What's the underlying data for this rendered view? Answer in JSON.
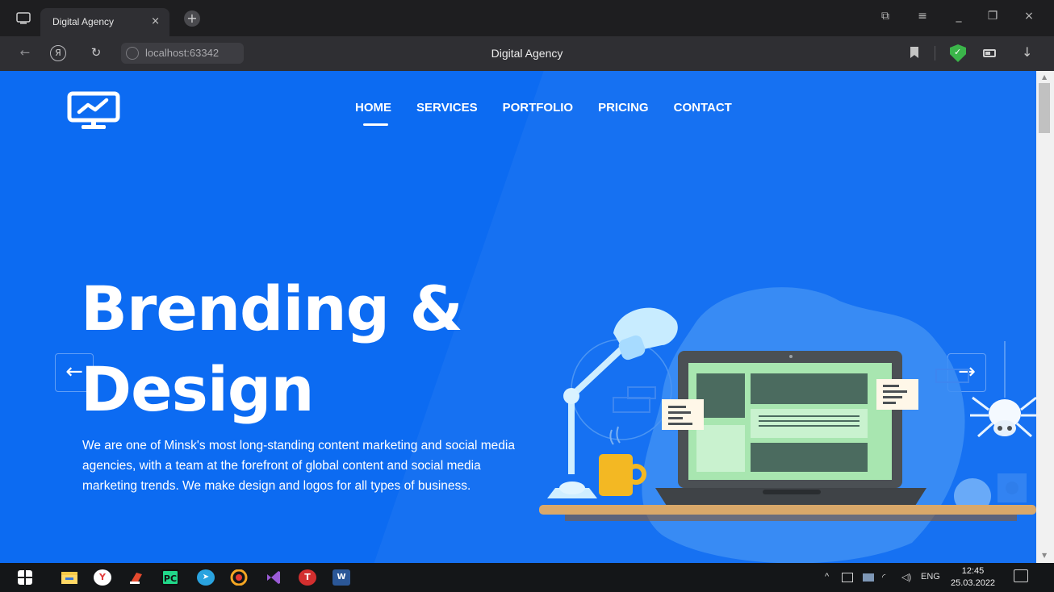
{
  "browser": {
    "tab_title": "Digital Agency",
    "tab_close": "×",
    "new_tab": "+",
    "url": "localhost:63342",
    "page_title": "Digital Agency",
    "back": "←",
    "reload": "↻",
    "yandex": "Я",
    "download": "↓",
    "shield_check": "✓",
    "window_controls": {
      "tablet": "⧉",
      "menu": "≡",
      "minimize": "_",
      "restore": "❐",
      "close": "×"
    }
  },
  "site": {
    "nav": [
      {
        "label": "HOME",
        "active": true
      },
      {
        "label": "SERVICES"
      },
      {
        "label": "PORTFOLIO"
      },
      {
        "label": "PRICING"
      },
      {
        "label": "CONTACT"
      }
    ],
    "hero_title_line1": "Brending &",
    "hero_title_line2": "Design",
    "hero_description": "We are one of Minsk's most long-standing content marketing and social media agencies, with a team at the forefront of global content and social media marketing trends. We make design and logos for all types of business.",
    "prev_arrow": "←",
    "next_arrow": "→"
  },
  "colors": {
    "brand_blue": "#0c6bf2",
    "screen_green": "#a8e6b0",
    "lamp_blue": "#c6ecff",
    "cup_yellow": "#f3b823",
    "desk_wood": "#d9a86a"
  },
  "taskbar": {
    "apps": [
      "windows-start",
      "file-explorer",
      "yandex-browser",
      "ccleaner",
      "pycharm",
      "telegram",
      "clock-app",
      "visual-studio",
      "app-t",
      "word"
    ],
    "pycharm_label": "PC",
    "app_t_label": "T",
    "word_label": "W",
    "yandex_label": "Y",
    "tray_chevron": "^",
    "language": "ENG",
    "time": "12:45",
    "date": "25.03.2022"
  }
}
